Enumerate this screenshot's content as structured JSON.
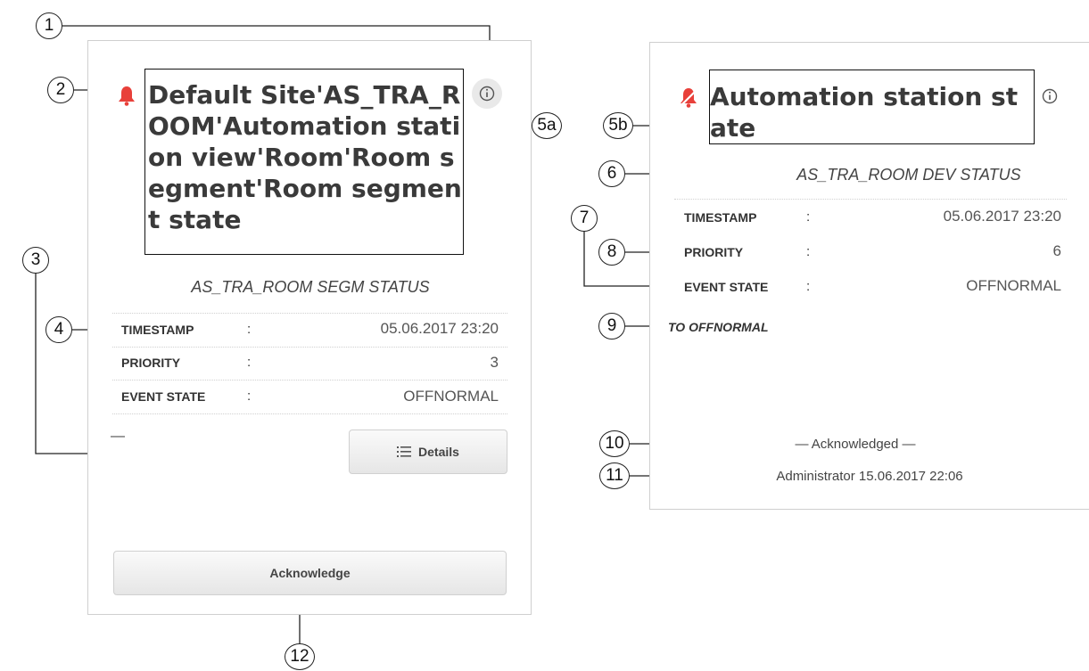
{
  "left_card": {
    "title": "Default Site'AS_TRA_ROOM'Automation station view'Room'Room segment'Room segment state",
    "subtitle": "AS_TRA_ROOM SEGM STATUS",
    "rows": [
      {
        "label": "TIMESTAMP",
        "value": "05.06.2017 23:20"
      },
      {
        "label": "PRIORITY",
        "value": "3"
      },
      {
        "label": "EVENT STATE",
        "value": "OFFNORMAL"
      }
    ],
    "dash": "—",
    "details_label": "Details",
    "acknowledge_label": "Acknowledge",
    "alarm_color": "#e8403a"
  },
  "right_card": {
    "title": "Automation station state",
    "subtitle": "AS_TRA_ROOM DEV STATUS",
    "rows": [
      {
        "label": "TIMESTAMP",
        "value": "05.06.2017 23:20"
      },
      {
        "label": "PRIORITY",
        "value": "6"
      },
      {
        "label": "EVENT STATE",
        "value": "OFFNORMAL"
      }
    ],
    "transition": "TO OFFNORMAL",
    "ack_status": "— Acknowledged —",
    "ack_by": "Administrator 15.06.2017 22:06",
    "alarm_color": "#e8403a"
  },
  "separator": ":",
  "callouts": [
    "1",
    "2",
    "3",
    "4",
    "5a",
    "5b",
    "6",
    "7",
    "8",
    "9",
    "10",
    "11",
    "12"
  ]
}
